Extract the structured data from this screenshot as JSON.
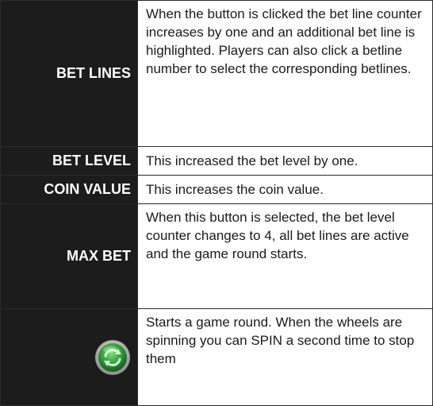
{
  "rows": [
    {
      "label": "BET LINES",
      "description": "When the button is clicked the bet line counter increases by one and an additional bet line is highlighted. Players can also click a betline number to select the corresponding betlines."
    },
    {
      "label": "BET LEVEL",
      "description": "This increased the bet level by one."
    },
    {
      "label": "COIN VALUE",
      "description": "This increases the coin value."
    },
    {
      "label": "MAX BET",
      "description": "When this button is selected, the bet level counter changes to 4, all bet lines are active and the game round starts."
    },
    {
      "icon": "spin-button-icon",
      "description": "Starts a game round. When the wheels are spinning you can SPIN a second time to stop them"
    }
  ],
  "colors": {
    "label_background": "#1c1c1c",
    "label_text": "#ffffff",
    "spin_green": "#2e9e3a"
  }
}
